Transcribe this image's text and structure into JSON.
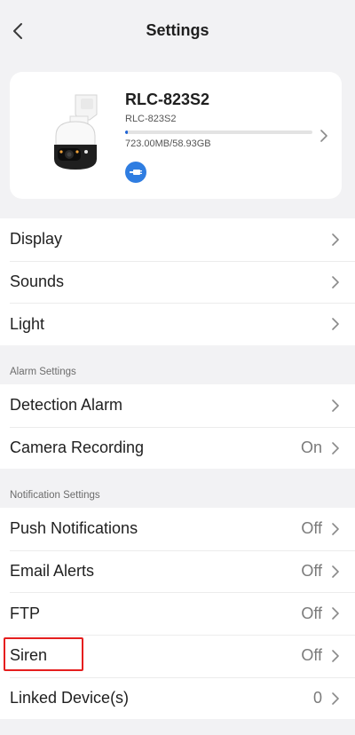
{
  "header": {
    "title": "Settings"
  },
  "device": {
    "name": "RLC-823S2",
    "model": "RLC-823S2",
    "storage": "723.00MB/58.93GB",
    "storage_used_fraction": 0.012,
    "connection_icon": "ethernet-icon",
    "accent_color": "#1e63d6"
  },
  "groups": {
    "general": {
      "items": [
        {
          "label": "Display",
          "value": ""
        },
        {
          "label": "Sounds",
          "value": ""
        },
        {
          "label": "Light",
          "value": ""
        }
      ]
    },
    "alarm": {
      "section_label": "Alarm Settings",
      "items": [
        {
          "label": "Detection Alarm",
          "value": ""
        },
        {
          "label": "Camera Recording",
          "value": "On"
        }
      ]
    },
    "notification": {
      "section_label": "Notification Settings",
      "items": [
        {
          "label": "Push Notifications",
          "value": "Off"
        },
        {
          "label": "Email Alerts",
          "value": "Off"
        },
        {
          "label": "FTP",
          "value": "Off"
        },
        {
          "label": "Siren",
          "value": "Off"
        },
        {
          "label": "Linked Device(s)",
          "value": "0"
        }
      ]
    }
  },
  "highlight_color": "#e51e1e"
}
